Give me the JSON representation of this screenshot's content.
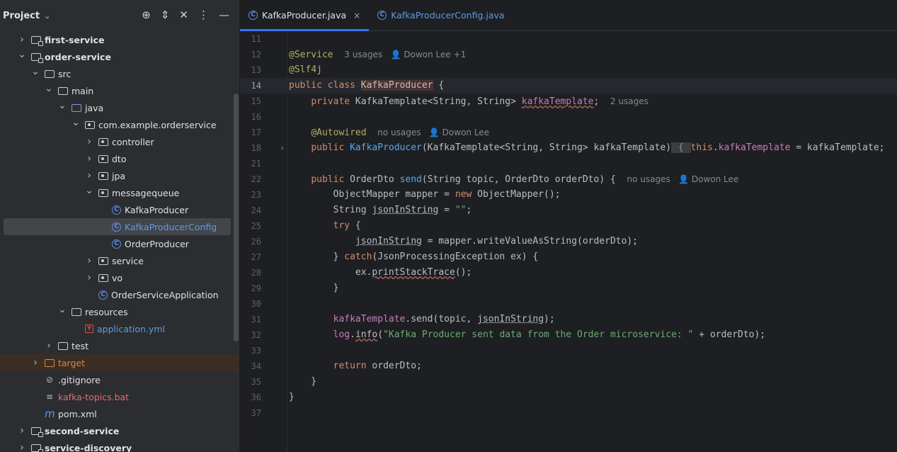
{
  "sidebar": {
    "title": "Project",
    "tree": [
      {
        "label": "first-service",
        "indent": 0,
        "arrow": "›",
        "icon": "module-folder",
        "bold": true
      },
      {
        "label": "order-service",
        "indent": 0,
        "arrow": "⌄",
        "icon": "module-folder",
        "bold": true
      },
      {
        "label": "src",
        "indent": 1,
        "arrow": "⌄",
        "icon": "folder"
      },
      {
        "label": "main",
        "indent": 2,
        "arrow": "⌄",
        "icon": "folder"
      },
      {
        "label": "java",
        "indent": 3,
        "arrow": "⌄",
        "icon": "source-folder"
      },
      {
        "label": "com.example.orderservice",
        "indent": 4,
        "arrow": "⌄",
        "icon": "package"
      },
      {
        "label": "controller",
        "indent": 5,
        "arrow": "›",
        "icon": "package"
      },
      {
        "label": "dto",
        "indent": 5,
        "arrow": "›",
        "icon": "package"
      },
      {
        "label": "jpa",
        "indent": 5,
        "arrow": "›",
        "icon": "package"
      },
      {
        "label": "messagequeue",
        "indent": 5,
        "arrow": "⌄",
        "icon": "package"
      },
      {
        "label": "KafkaProducer",
        "indent": 6,
        "arrow": "",
        "icon": "class"
      },
      {
        "label": "KafkaProducerConfig",
        "indent": 6,
        "arrow": "",
        "icon": "class",
        "selected": true,
        "color": "blue"
      },
      {
        "label": "OrderProducer",
        "indent": 6,
        "arrow": "",
        "icon": "class"
      },
      {
        "label": "service",
        "indent": 5,
        "arrow": "›",
        "icon": "package"
      },
      {
        "label": "vo",
        "indent": 5,
        "arrow": "›",
        "icon": "package"
      },
      {
        "label": "OrderServiceApplication",
        "indent": 5,
        "arrow": "",
        "icon": "class"
      },
      {
        "label": "resources",
        "indent": 3,
        "arrow": "⌄",
        "icon": "resources-folder"
      },
      {
        "label": "application.yml",
        "indent": 4,
        "arrow": "",
        "icon": "yml",
        "color": "blue"
      },
      {
        "label": "test",
        "indent": 2,
        "arrow": "›",
        "icon": "folder"
      },
      {
        "label": "target",
        "indent": 1,
        "arrow": "›",
        "icon": "excluded-folder",
        "color": "orange",
        "excluded": true
      },
      {
        "label": ".gitignore",
        "indent": 1,
        "arrow": "",
        "icon": "ignore"
      },
      {
        "label": "kafka-topics.bat",
        "indent": 1,
        "arrow": "",
        "icon": "text-file",
        "color": "red"
      },
      {
        "label": "pom.xml",
        "indent": 1,
        "arrow": "",
        "icon": "maven"
      },
      {
        "label": "second-service",
        "indent": 0,
        "arrow": "›",
        "icon": "module-folder",
        "bold": true
      },
      {
        "label": "service-discovery",
        "indent": 0,
        "arrow": "›",
        "icon": "module-folder",
        "bold": true
      }
    ]
  },
  "tabs": [
    {
      "label": "KafkaProducer.java",
      "active": true
    },
    {
      "label": "KafkaProducerConfig.java",
      "active": false
    }
  ],
  "code": {
    "lines": [
      {
        "n": "11",
        "html": ""
      },
      {
        "n": "12",
        "html": "<span class='ann'>@Service</span>  <span class='hint'>3 usages   &#128100; Dowon Lee +1</span>"
      },
      {
        "n": "13",
        "html": "<span class='ann'>@Slf4j</span>"
      },
      {
        "n": "14",
        "html": "<span class='kw'>public class</span> <span class='hl'>KafkaProducer</span> {",
        "cur": true
      },
      {
        "n": "15",
        "html": "    <span class='kw'>private</span> KafkaTemplate&lt;String, String&gt; <span class='fld uline'>kafkaTemplate</span>;  <span class='hint'>2 usages</span>"
      },
      {
        "n": "16",
        "html": ""
      },
      {
        "n": "17",
        "html": "    <span class='ann'>@Autowired</span>  <span class='hint'>no usages   &#128100; Dowon Lee</span>"
      },
      {
        "n": "18",
        "html": "    <span class='kw'>public</span> <span class='fn'>KafkaProducer</span>(KafkaTemplate&lt;String, String&gt; kafkaTemplate)<span class='brace'> { </span><span class='kw'>this</span>.<span class='fld'>kafkaTemplate</span> = kafkaTemplate;",
        "fold": true
      },
      {
        "n": "21",
        "html": ""
      },
      {
        "n": "22",
        "html": "    <span class='kw'>public</span> OrderDto <span class='fn'>send</span>(String topic, OrderDto orderDto) {  <span class='hint'>no usages   &#128100; Dowon Lee</span>"
      },
      {
        "n": "23",
        "html": "        ObjectMapper mapper = <span class='kw'>new</span> ObjectMapper();"
      },
      {
        "n": "24",
        "html": "        String <span class='sline'>jsonInString</span> = <span class='str'>\"\"</span>;"
      },
      {
        "n": "25",
        "html": "        <span class='kw'>try</span> {"
      },
      {
        "n": "26",
        "html": "            <span class='sline'>jsonInString</span> = mapper.writeValueAsString(orderDto);"
      },
      {
        "n": "27",
        "html": "        } <span class='kw'>catch</span>(JsonProcessingException ex) {"
      },
      {
        "n": "28",
        "html": "            ex.<span class='uline'>printStackTrace</span>();"
      },
      {
        "n": "29",
        "html": "        }"
      },
      {
        "n": "30",
        "html": ""
      },
      {
        "n": "31",
        "html": "        <span class='fld'>kafkaTemplate</span>.send(topic, <span class='sline'>jsonInString</span>);"
      },
      {
        "n": "32",
        "html": "        <span class='fld'>log</span>.<span class='uline'>info</span>(<span class='str'>\"Kafka Producer sent data from the Order microservice: \"</span> + orderDto);"
      },
      {
        "n": "33",
        "html": ""
      },
      {
        "n": "34",
        "html": "        <span class='kw'>return</span> orderDto;"
      },
      {
        "n": "35",
        "html": "    }"
      },
      {
        "n": "36",
        "html": "}"
      },
      {
        "n": "37",
        "html": ""
      }
    ]
  },
  "icons": {
    "crosshair": "⊕",
    "expand": "⇕",
    "collapse": "✕",
    "more": "⋮",
    "minimize": "—"
  }
}
